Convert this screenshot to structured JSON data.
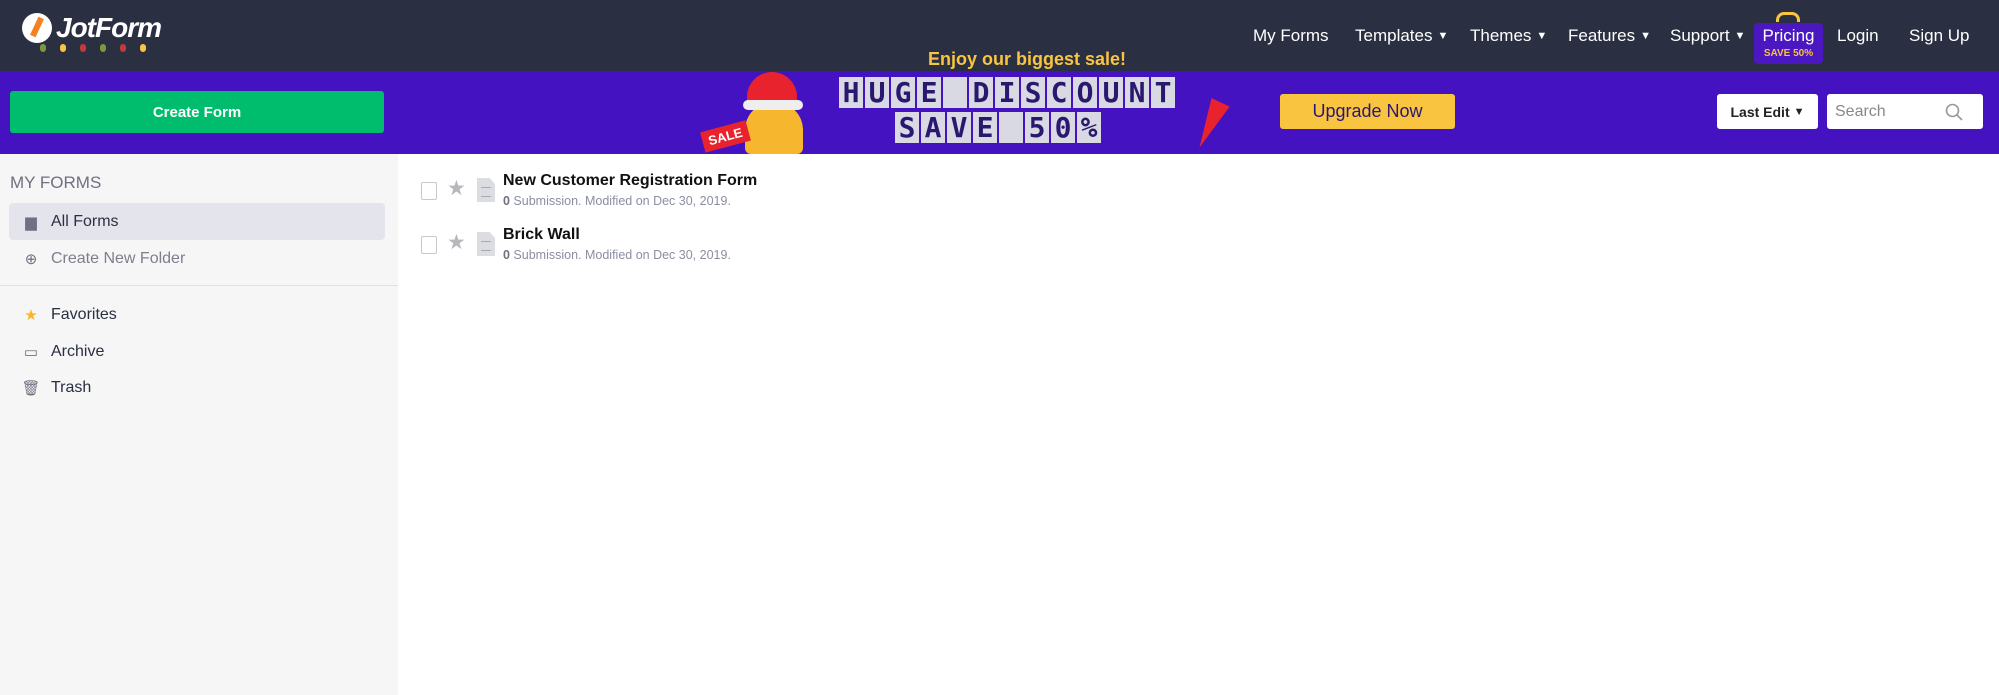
{
  "header": {
    "logo": "JotForm",
    "nav": [
      {
        "label": "My Forms",
        "dropdown": false
      },
      {
        "label": "Templates",
        "dropdown": true
      },
      {
        "label": "Themes",
        "dropdown": true
      },
      {
        "label": "Features",
        "dropdown": true
      },
      {
        "label": "Support",
        "dropdown": true
      }
    ],
    "pricing": {
      "label": "Pricing",
      "badge": "SAVE 50%"
    },
    "login": "Login",
    "signup": "Sign Up"
  },
  "banner": {
    "create_form": "Create Form",
    "tagline": "Enjoy our biggest sale!",
    "line1": "HUGE DISCOUNT",
    "line2": "SAVE 50%",
    "sale_tag": "SALE",
    "upgrade": "Upgrade Now",
    "sort": "Last Edit",
    "search_placeholder": "Search"
  },
  "sidebar": {
    "heading": "MY FORMS",
    "items": [
      {
        "label": "All Forms",
        "icon": "folder-icon"
      },
      {
        "label": "Create New Folder",
        "icon": "plus-circle-icon"
      },
      {
        "label": "Favorites",
        "icon": "star-icon"
      },
      {
        "label": "Archive",
        "icon": "inbox-icon"
      },
      {
        "label": "Trash",
        "icon": "trash-icon"
      }
    ]
  },
  "forms": [
    {
      "title": "New Customer Registration Form",
      "count": "0",
      "meta": " Submission. Modified on Dec 30, 2019."
    },
    {
      "title": "Brick Wall",
      "count": "0",
      "meta": " Submission. Modified on Dec 30, 2019."
    }
  ],
  "colors": {
    "header": "#2a2f42",
    "banner": "#4512c2",
    "create": "#00bd6e",
    "upgrade": "#f9c440"
  }
}
